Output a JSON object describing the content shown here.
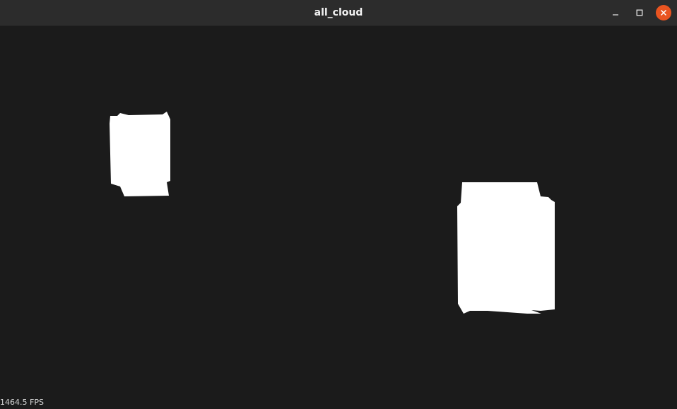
{
  "window": {
    "title": "all_cloud",
    "controls": {
      "minimize_icon": "minimize-icon",
      "maximize_icon": "maximize-icon",
      "close_icon": "close-icon"
    },
    "colors": {
      "titlebar": "#2c2c2c",
      "background": "#1b1b1b",
      "close_button": "#e95420",
      "point_cloud": "#ffffff"
    }
  },
  "viewport": {
    "fps_label": "1464.5 FPS"
  }
}
